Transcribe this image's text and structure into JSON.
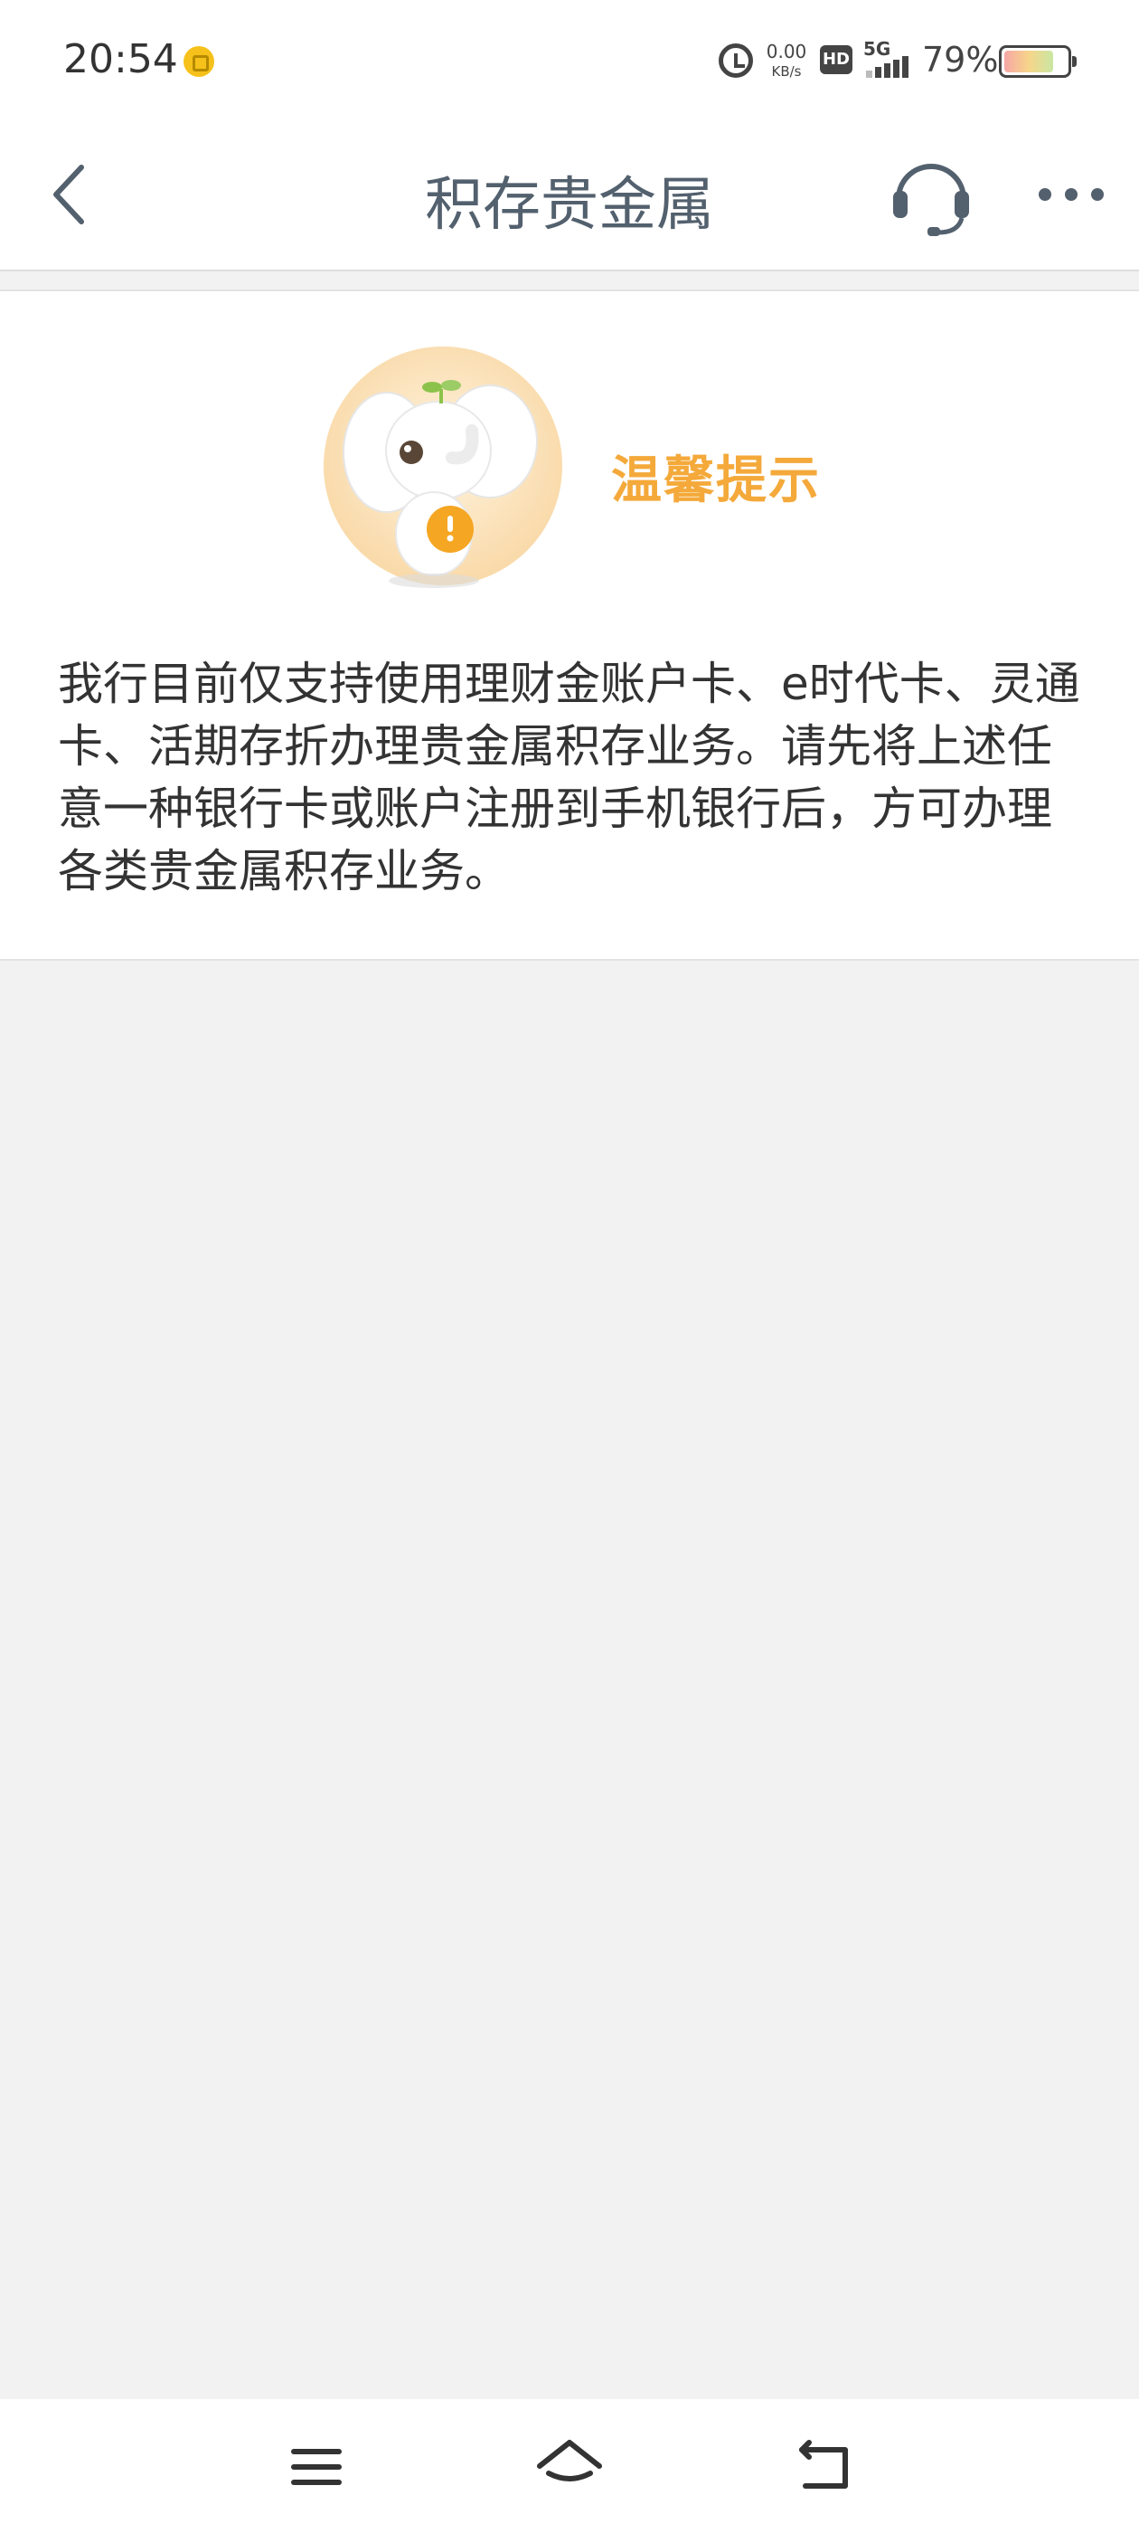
{
  "status_bar": {
    "time": "20:54",
    "net_speed_value": "0.00",
    "net_speed_unit": "KB/s",
    "hd_label": "HD",
    "network_label": "5G",
    "battery_percent_text": "79%",
    "battery_level": 0.79,
    "icons": [
      "coin-notification-icon",
      "alarm-icon",
      "signal-icon",
      "battery-icon"
    ]
  },
  "nav": {
    "title": "积存贵金属",
    "back_icon": "chevron-left-icon",
    "support_icon": "headset-icon",
    "more_icon": "more-dots-icon",
    "icon_color": "#53606e"
  },
  "notice": {
    "title": "温馨提示",
    "title_color": "#f4a93a",
    "body": "我行目前仅支持使用理财金账户卡、e时代卡、灵通卡、活期存折办理贵金属积存业务。请先将上述任意一种银行卡或账户注册到手机银行后，方可办理各类贵金属积存业务。",
    "illustration": "elephant-mascot-warning"
  },
  "system_nav": {
    "icons": [
      "menu-icon",
      "home-icon",
      "back-icon"
    ]
  }
}
